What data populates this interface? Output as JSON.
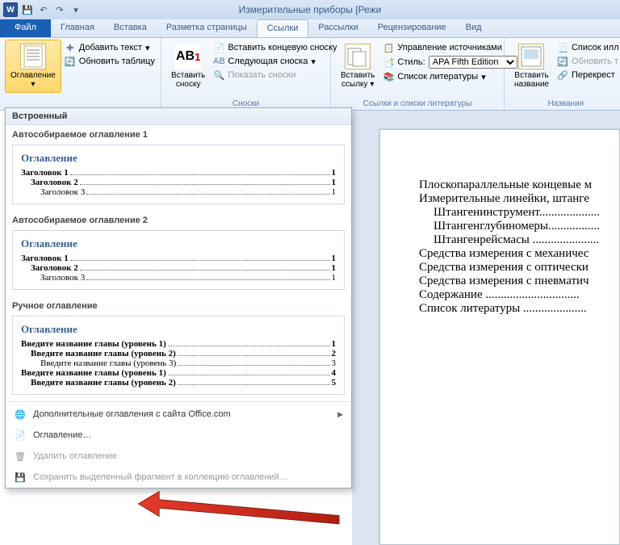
{
  "title": "Измерительные приборы [Режи",
  "qat": {
    "save": "💾",
    "undo": "↶",
    "redo": "↷"
  },
  "tabs": {
    "file": "Файл",
    "home": "Главная",
    "insert": "Вставка",
    "layout": "Разметка страницы",
    "references": "Ссылки",
    "mailings": "Рассылки",
    "review": "Рецензирование",
    "view": "Вид"
  },
  "ribbon": {
    "toc": {
      "label": "Оглавление",
      "add_text": "Добавить текст",
      "update": "Обновить таблицу"
    },
    "footnotes": {
      "label": "Сноски",
      "insert": "Вставить сноску",
      "ab": "AB",
      "endnote": "Вставить концевую сноску",
      "next": "Следующая сноска",
      "show": "Показать сноски"
    },
    "citations": {
      "label": "Ссылки и списки литературы",
      "insert_link": "Вставить ссылку",
      "manage": "Управление источниками",
      "style": "Стиль:",
      "style_value": "APA Fifth Edition",
      "biblio": "Список литературы"
    },
    "captions": {
      "label": "Названия",
      "insert": "Вставить название",
      "list_illus": "Список илл",
      "update": "Обновить т",
      "crossref": "Перекрест"
    }
  },
  "dropdown": {
    "builtin": "Встроенный",
    "auto1": "Автособираемое оглавление 1",
    "auto2": "Автособираемое оглавление 2",
    "manual": "Ручное оглавление",
    "preview": {
      "title": "Оглавление",
      "h1": "Заголовок 1",
      "h2": "Заголовок 2",
      "h3": "Заголовок 3",
      "m1": "Введите название главы (уровень 1)",
      "m2": "Введите название главы (уровень 2)",
      "m3": "Введите название главы (уровень 3)",
      "p1": "1",
      "p2": "2",
      "p3": "3",
      "p4": "4",
      "p5": "5"
    },
    "more": "Дополнительные оглавления с сайта Office.com",
    "custom": "Оглавление…",
    "remove": "Удалить оглавление",
    "save_sel": "Сохранить выделенный фрагмент в коллекцию оглавлений…"
  },
  "document": {
    "l1": "Плоскопараллельные концевые м",
    "l2": "Измерительные линейки, штанге",
    "l3": "Штангенинструмент....................",
    "l4": "Штангенглубиномеры.................",
    "l5": "Штангенрейсмасы ......................",
    "l6": "Средства измерения с механичес",
    "l7": "Средства измерения с оптически",
    "l8": "Средства измерения с пневматич",
    "l9": "Содержание ...............................",
    "l10": "Список литературы ....................."
  }
}
